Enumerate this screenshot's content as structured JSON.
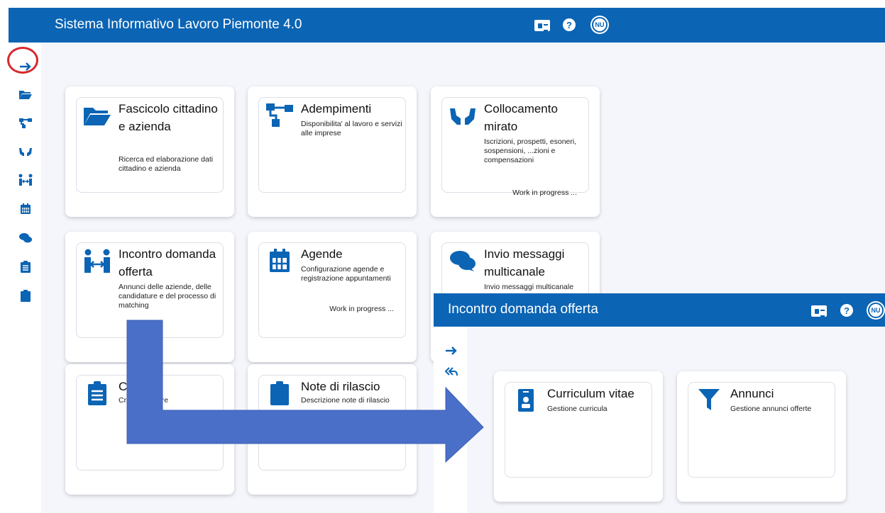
{
  "main": {
    "title": "Sistema Informativo Lavoro Piemonte 4.0",
    "header_icons": {
      "id_card": "id-card-icon",
      "help": "?",
      "avatar": "NU"
    },
    "sidebar_icons": [
      "arrow-right-icon",
      "folder-open-icon",
      "sitemap-icon",
      "hands-icon",
      "people-arrows-icon",
      "calendar-icon",
      "comments-icon",
      "clipboard-list-icon",
      "clipboard-icon"
    ],
    "cards": [
      {
        "title": "Fascicolo cittadino e azienda",
        "desc": "Ricerca ed elaborazione dati cittadino e azienda",
        "icon": "folder-open-icon"
      },
      {
        "title": "Adempimenti",
        "desc": "Disponibilita' al lavoro e servizi alle imprese",
        "icon": "sitemap-icon"
      },
      {
        "title": "Collocamento mirato",
        "desc": "Iscrizioni, prospetti, esoneri, sospensioni, ...zioni e compensazioni",
        "wip": "Work in progress ...",
        "icon": "hands-icon"
      },
      {
        "title": "Incontro domanda offerta",
        "desc": "Annunci delle aziende, delle candidature e del processo di matching",
        "icon": "people-arrows-icon"
      },
      {
        "title": "Agende",
        "desc": "Configurazione agende e registrazione appuntamenti",
        "wip": "Work in progress ...",
        "icon": "calendar-icon"
      },
      {
        "title": "Invio messaggi multicanale",
        "desc": "Invio messaggi multicanale",
        "icon": "comments-icon"
      },
      {
        "title": "C...to",
        "desc": "Cr... ...peratore",
        "icon": "clipboard-list-icon"
      },
      {
        "title": "Note di rilascio",
        "desc": "Descrizione note di rilascio",
        "icon": "clipboard-icon"
      }
    ]
  },
  "sub": {
    "title": "Incontro domanda offerta",
    "header_icons": {
      "id_card": "id-card-icon",
      "help": "?",
      "avatar": "NU"
    },
    "sidebar_icons": [
      "arrow-right-icon",
      "reply-all-icon",
      "play-icon"
    ],
    "cards": [
      {
        "title": "Curriculum vitae",
        "desc": "Gestione curricula",
        "icon": "id-badge-icon"
      },
      {
        "title": "Annunci",
        "desc": "Gestione annunci offerte",
        "icon": "filter-icon"
      }
    ]
  },
  "colors": {
    "brand": "#0b64b4",
    "arrow": "#4a6fc9",
    "highlight": "#d8272d"
  }
}
